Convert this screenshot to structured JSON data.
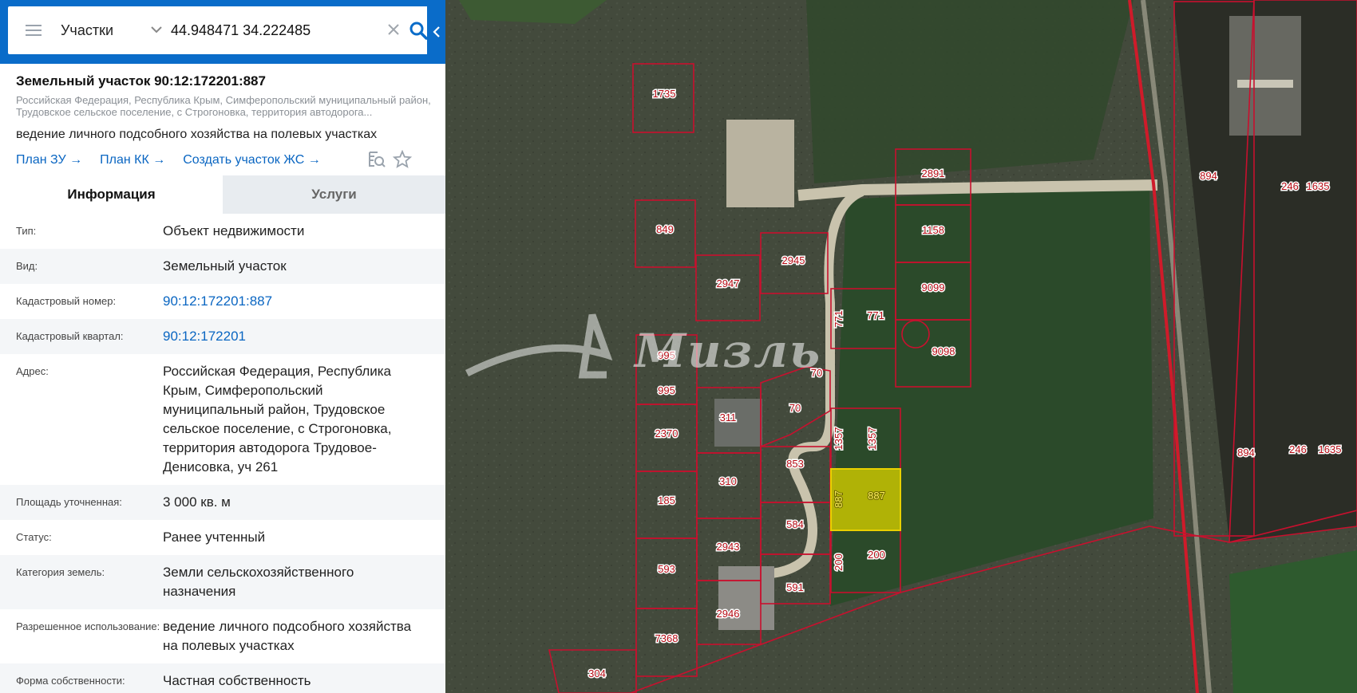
{
  "search": {
    "type_label": "Участки",
    "query": "44.948471 34.222485"
  },
  "parcel": {
    "title": "Земельный участок 90:12:172201:887",
    "address_short": "Российская Федерация, Республика Крым, Симферопольский муниципальный район, Трудовское сельское поселение, с Строгоновка, территория автодорога...",
    "purpose": "ведение личного подсобного хозяйства на полевых участках",
    "links": [
      "План ЗУ →",
      "План КК →",
      "Создать участок ЖС →"
    ]
  },
  "tabs": [
    "Информация",
    "Услуги"
  ],
  "info_rows": [
    {
      "key": "Тип:",
      "value": "Объект недвижимости"
    },
    {
      "key": "Вид:",
      "value": "Земельный участок"
    },
    {
      "key": "Кадастровый номер:",
      "value": "90:12:172201:887"
    },
    {
      "key": "Кадастровый квартал:",
      "value": "90:12:172201"
    },
    {
      "key": "Адрес:",
      "value": "Российская Федерация, Республика Крым, Симферопольский муниципальный район, Трудовское сельское поселение, с Строгоновка, территория автодорога Трудовое-Денисовка, уч 261"
    },
    {
      "key": "Площадь уточненная:",
      "value": "3 000 кв. м"
    },
    {
      "key": "Статус:",
      "value": "Ранее учтенный"
    },
    {
      "key": "Категория земель:",
      "value": "Земли сельскохозяйственного назначения"
    },
    {
      "key": "Разрешенное использование:",
      "value": "ведение личного подсобного хозяйства на полевых участках"
    },
    {
      "key": "Форма собственности:",
      "value": "Частная собственность"
    }
  ],
  "map": {
    "watermark": "Мизль",
    "plot_labels": [
      "1735",
      "2891",
      "849",
      "2945",
      "2947",
      "1158",
      "9099",
      "771",
      "771",
      "9098",
      "995",
      "995",
      "70",
      "70",
      "311",
      "2370",
      "1357",
      "1357",
      "853",
      "310",
      "887",
      "887",
      "185",
      "584",
      "2943",
      "200",
      "200",
      "593",
      "591",
      "2946",
      "7368",
      "304",
      "894",
      "246",
      "1635",
      "894",
      "246",
      "1635"
    ],
    "selected_plot": "887",
    "colors": {
      "boundary": "#c8102e",
      "selected_fill": "#c8c400",
      "primary": "#0a6cc9",
      "link": "#0a66c2"
    }
  }
}
